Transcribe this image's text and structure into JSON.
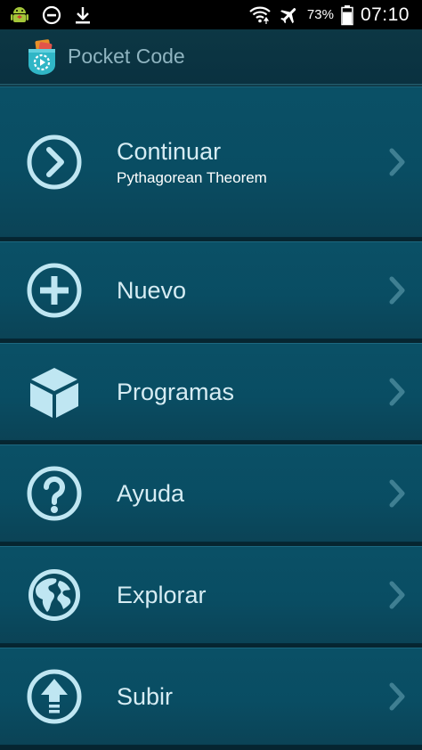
{
  "status_bar": {
    "icons": [
      "android-debug-icon",
      "do-not-disturb-icon",
      "download-icon",
      "wifi-icon",
      "airplane-mode-icon",
      "battery-icon"
    ],
    "battery_percent": "73%",
    "time": "07:10"
  },
  "app_bar": {
    "title": "Pocket Code",
    "logo_icon": "pocket-code-logo"
  },
  "menu": {
    "items": [
      {
        "label": "Continuar",
        "sublabel": "Pythagorean Theorem",
        "icon": "arrow-circle-icon"
      },
      {
        "label": "Nuevo",
        "icon": "plus-circle-icon"
      },
      {
        "label": "Programas",
        "icon": "cube-icon"
      },
      {
        "label": "Ayuda",
        "icon": "question-circle-icon"
      },
      {
        "label": "Explorar",
        "icon": "globe-icon"
      },
      {
        "label": "Subir",
        "icon": "upload-circle-icon"
      }
    ]
  },
  "colors": {
    "background": "#062530",
    "menu_item": "#0a5066",
    "icon": "#bfe6f2",
    "label": "#d6ecf3",
    "chevron": "#3f7f92"
  }
}
